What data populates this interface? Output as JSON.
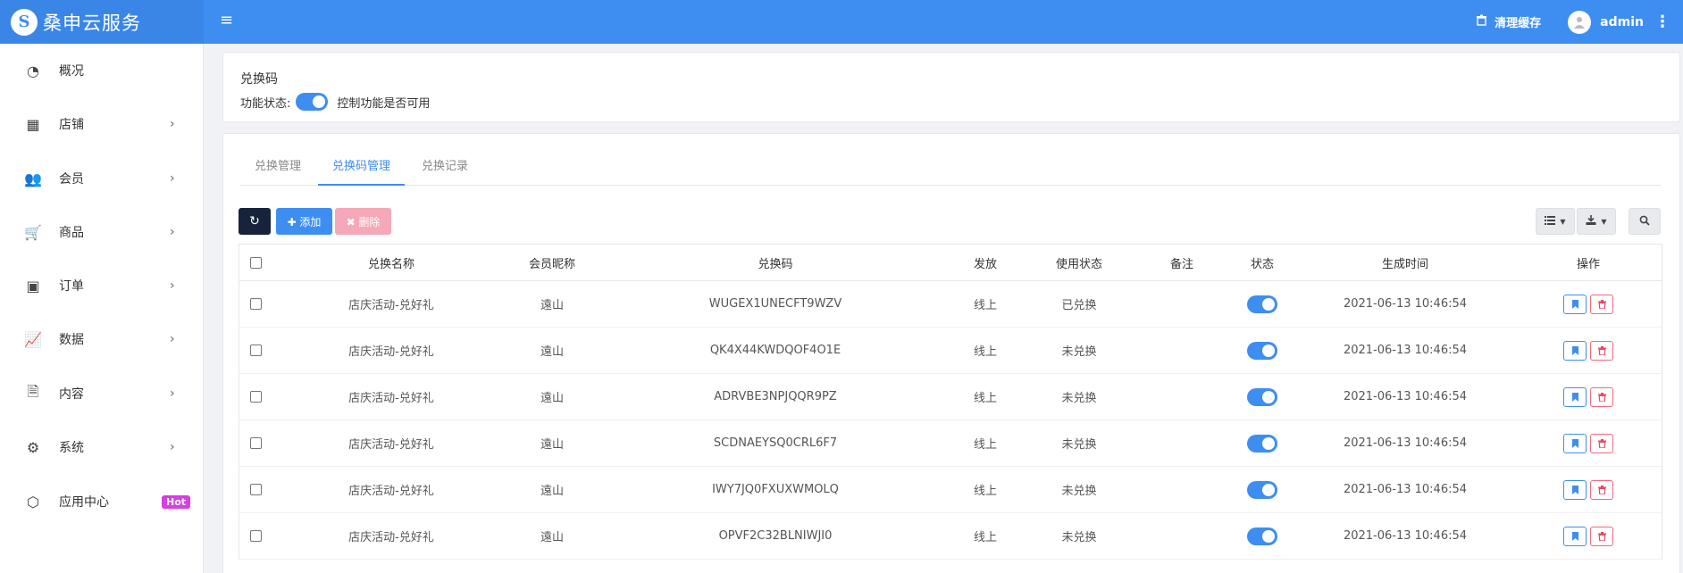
{
  "brand": {
    "logo_glyph": "S",
    "name": "桑申云服务"
  },
  "topbar": {
    "menu_glyph": "≡",
    "clear_cache_label": "清理缓存",
    "user_name": "admin",
    "accent_color": "#3d8ef0"
  },
  "sidebar": {
    "items": [
      {
        "label": "概况",
        "icon": "dashboard-icon",
        "glyph": "◔",
        "has_arrow": false
      },
      {
        "label": "店铺",
        "icon": "grid-icon",
        "glyph": "▦",
        "has_arrow": true
      },
      {
        "label": "会员",
        "icon": "users-icon",
        "glyph": "👥",
        "has_arrow": true
      },
      {
        "label": "商品",
        "icon": "cart-icon",
        "glyph": "🛒",
        "has_arrow": true
      },
      {
        "label": "订单",
        "icon": "money-icon",
        "glyph": "▣",
        "has_arrow": true
      },
      {
        "label": "数据",
        "icon": "line-chart-icon",
        "glyph": "📈",
        "has_arrow": true
      },
      {
        "label": "内容",
        "icon": "document-icon",
        "glyph": "🗎",
        "has_arrow": true
      },
      {
        "label": "系统",
        "icon": "gear-icon",
        "glyph": "⚙",
        "has_arrow": true
      },
      {
        "label": "应用中心",
        "icon": "cube-icon",
        "glyph": "⬡",
        "has_arrow": false,
        "badge": "Hot"
      }
    ]
  },
  "feature_panel": {
    "title": "兑换码",
    "status_label": "功能状态:",
    "status_on": true,
    "status_hint": "控制功能是否可用"
  },
  "tabs": [
    {
      "label": "兑换管理",
      "active": false
    },
    {
      "label": "兑换码管理",
      "active": true
    },
    {
      "label": "兑换记录",
      "active": false
    }
  ],
  "toolbar": {
    "refresh_glyph": "↻",
    "add_label": "✚ 添加",
    "delete_label": "✖ 删除"
  },
  "table": {
    "headers": [
      "兑换名称",
      "会员昵称",
      "兑换码",
      "发放",
      "使用状态",
      "备注",
      "状态",
      "生成时间",
      "操作"
    ],
    "rows": [
      {
        "name": "店庆活动-兑好礼",
        "member": "遠山",
        "code": "WUGEX1UNECFT9WZV",
        "issue": "线上",
        "use_status": "已兑换",
        "remark": "",
        "enabled": true,
        "created": "2021-06-13 10:46:54"
      },
      {
        "name": "店庆活动-兑好礼",
        "member": "遠山",
        "code": "QK4X44KWDQOF4O1E",
        "issue": "线上",
        "use_status": "未兑换",
        "remark": "",
        "enabled": true,
        "created": "2021-06-13 10:46:54"
      },
      {
        "name": "店庆活动-兑好礼",
        "member": "遠山",
        "code": "ADRVBE3NPJQQR9PZ",
        "issue": "线上",
        "use_status": "未兑换",
        "remark": "",
        "enabled": true,
        "created": "2021-06-13 10:46:54"
      },
      {
        "name": "店庆活动-兑好礼",
        "member": "遠山",
        "code": "SCDNAEYSQ0CRL6F7",
        "issue": "线上",
        "use_status": "未兑换",
        "remark": "",
        "enabled": true,
        "created": "2021-06-13 10:46:54"
      },
      {
        "name": "店庆活动-兑好礼",
        "member": "遠山",
        "code": "IWY7JQ0FXUXWMOLQ",
        "issue": "线上",
        "use_status": "未兑换",
        "remark": "",
        "enabled": true,
        "created": "2021-06-13 10:46:54"
      },
      {
        "name": "店庆活动-兑好礼",
        "member": "遠山",
        "code": "OPVF2C32BLNIWJI0",
        "issue": "线上",
        "use_status": "未兑换",
        "remark": "",
        "enabled": true,
        "created": "2021-06-13 10:46:54"
      }
    ]
  }
}
